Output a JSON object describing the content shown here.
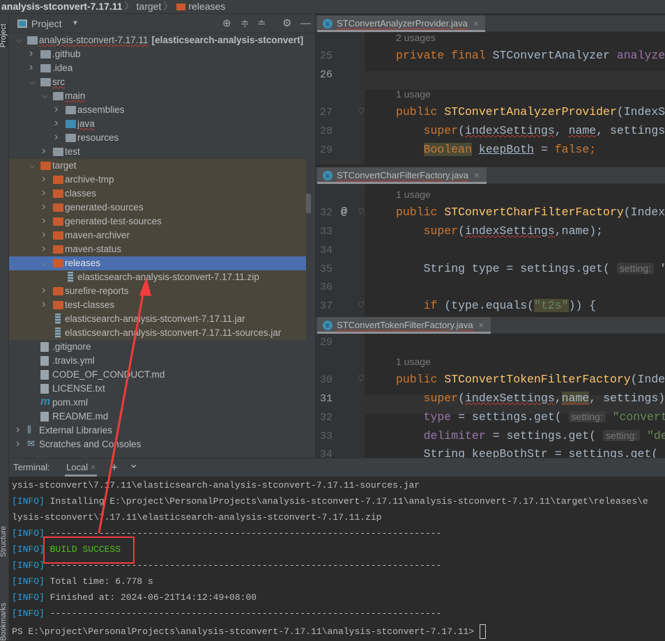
{
  "breadcrumb": [
    "analysis-stconvert-7.17.11",
    "target",
    "releases"
  ],
  "left_strip": {
    "project": "Project",
    "structure": "Structure",
    "bookmarks": "Bookmarks"
  },
  "project_panel": {
    "title": "Project",
    "icons": [
      "locate-icon",
      "expand-all-icon",
      "collapse-all-icon",
      "gear-icon",
      "minimize-icon"
    ]
  },
  "tree": [
    {
      "label": "analysis-stconvert-7.17.11",
      "extra": "[elasticsearch-analysis-stconvert]",
      "depth": 0,
      "icon": "module",
      "chevron": "open",
      "wavy": true
    },
    {
      "label": ".github",
      "depth": 1,
      "icon": "folder",
      "chevron": "closed"
    },
    {
      "label": ".idea",
      "depth": 1,
      "icon": "folder",
      "chevron": "closed"
    },
    {
      "label": "src",
      "depth": 1,
      "icon": "folder",
      "chevron": "open",
      "wavy": true
    },
    {
      "label": "main",
      "depth": 2,
      "icon": "folder",
      "chevron": "open",
      "wavy": true
    },
    {
      "label": "assemblies",
      "depth": 3,
      "icon": "folder",
      "chevron": "closed"
    },
    {
      "label": "java",
      "depth": 3,
      "icon": "source-folder",
      "chevron": "closed",
      "wavy": true
    },
    {
      "label": "resources",
      "depth": 3,
      "icon": "resource-folder",
      "chevron": "closed"
    },
    {
      "label": "test",
      "depth": 2,
      "icon": "folder",
      "chevron": "closed"
    },
    {
      "label": "target",
      "depth": 1,
      "icon": "excluded-folder",
      "chevron": "open",
      "state": "excluded"
    },
    {
      "label": "archive-tmp",
      "depth": 2,
      "icon": "excluded-folder",
      "chevron": "closed",
      "state": "excluded"
    },
    {
      "label": "classes",
      "depth": 2,
      "icon": "excluded-folder",
      "chevron": "closed",
      "state": "excluded"
    },
    {
      "label": "generated-sources",
      "depth": 2,
      "icon": "excluded-folder",
      "chevron": "closed",
      "state": "excluded"
    },
    {
      "label": "generated-test-sources",
      "depth": 2,
      "icon": "excluded-folder",
      "chevron": "closed",
      "state": "excluded"
    },
    {
      "label": "maven-archiver",
      "depth": 2,
      "icon": "excluded-folder",
      "chevron": "closed",
      "state": "excluded"
    },
    {
      "label": "maven-status",
      "depth": 2,
      "icon": "excluded-folder",
      "chevron": "closed",
      "state": "excluded"
    },
    {
      "label": "releases",
      "depth": 2,
      "icon": "excluded-folder",
      "chevron": "open",
      "state": "selected"
    },
    {
      "label": "elasticsearch-analysis-stconvert-7.17.11.zip",
      "depth": 3,
      "icon": "archive",
      "chevron": "none",
      "state": "excluded"
    },
    {
      "label": "surefire-reports",
      "depth": 2,
      "icon": "excluded-folder",
      "chevron": "closed",
      "state": "excluded"
    },
    {
      "label": "test-classes",
      "depth": 2,
      "icon": "excluded-folder",
      "chevron": "closed",
      "state": "excluded"
    },
    {
      "label": "elasticsearch-analysis-stconvert-7.17.11.jar",
      "depth": 2,
      "icon": "archive",
      "chevron": "none",
      "state": "excluded"
    },
    {
      "label": "elasticsearch-analysis-stconvert-7.17.11-sources.jar",
      "depth": 2,
      "icon": "archive",
      "chevron": "none",
      "state": "excluded"
    },
    {
      "label": ".gitignore",
      "depth": 1,
      "icon": "file",
      "chevron": "none"
    },
    {
      "label": ".travis.yml",
      "depth": 1,
      "icon": "yml-file",
      "chevron": "none"
    },
    {
      "label": "CODE_OF_CONDUCT.md",
      "depth": 1,
      "icon": "md-file",
      "chevron": "none"
    },
    {
      "label": "LICENSE.txt",
      "depth": 1,
      "icon": "text-file",
      "chevron": "none"
    },
    {
      "label": "pom.xml",
      "depth": 1,
      "icon": "maven-file",
      "chevron": "none"
    },
    {
      "label": "README.md",
      "depth": 1,
      "icon": "md-file",
      "chevron": "none"
    },
    {
      "label": "External Libraries",
      "depth": 0,
      "icon": "libraries",
      "chevron": "closed"
    },
    {
      "label": "Scratches and Consoles",
      "depth": 0,
      "icon": "scratches",
      "chevron": "closed"
    }
  ],
  "editor_panes": [
    {
      "tab": "STConvertAnalyzerProvider.java",
      "lines": [
        {
          "usage": "2 usages"
        },
        {
          "n": "25",
          "code": [
            [
              "private final ",
              "kw"
            ],
            [
              "STConvertAnalyzer ",
              ""
            ],
            [
              "analyze",
              "fd"
            ]
          ]
        },
        {
          "n": "26",
          "current": true,
          "code": []
        },
        {
          "usage": "1 usage"
        },
        {
          "n": "27",
          "fold": true,
          "code": [
            [
              "public ",
              "kw"
            ],
            [
              "STConvertAnalyzerProvider",
              "mt"
            ],
            [
              "(IndexS",
              ""
            ]
          ]
        },
        {
          "n": "28",
          "code": [
            [
              "    super",
              "kw"
            ],
            [
              "(",
              ""
            ],
            [
              "indexSettings",
              "sq"
            ],
            [
              ", ",
              ""
            ],
            [
              "name",
              "sq"
            ],
            [
              ", settings",
              ""
            ]
          ]
        },
        {
          "n": "29",
          "code": [
            [
              "    ",
              ""
            ],
            [
              "Boolean",
              "kw hlb"
            ],
            [
              " ",
              ""
            ],
            [
              "keepBoth",
              "ul"
            ],
            [
              " = ",
              ""
            ],
            [
              "false;",
              "kw"
            ]
          ]
        }
      ]
    },
    {
      "tab": "STConvertCharFilterFactory.java",
      "lines": [
        {
          "usage": "1 usage"
        },
        {
          "n": "32",
          "at": "@",
          "fold": true,
          "code": [
            [
              "public ",
              "kw"
            ],
            [
              "STConvertCharFilterFactory",
              "mt"
            ],
            [
              "(Index",
              ""
            ]
          ]
        },
        {
          "n": "33",
          "code": [
            [
              "    super",
              "kw"
            ],
            [
              "(",
              ""
            ],
            [
              "indexSettings",
              "sq"
            ],
            [
              ",name);",
              ""
            ]
          ]
        },
        {
          "n": "34",
          "code": []
        },
        {
          "n": "35",
          "code": [
            [
              "    String type = settings.get( ",
              ""
            ],
            [
              "setting:",
              "hint"
            ],
            [
              " \"",
              ""
            ]
          ]
        },
        {
          "n": "36",
          "code": []
        },
        {
          "n": "37",
          "fold": true,
          "code": [
            [
              "    if ",
              "kw"
            ],
            [
              "(type.equals(",
              ""
            ],
            [
              "\"t2s\"",
              "st hlb"
            ],
            [
              ")) {",
              ""
            ]
          ]
        }
      ]
    },
    {
      "tab": "STConvertTokenFilterFactory.java",
      "lines": [
        {
          "n": "29",
          "code": []
        },
        {
          "usage": "1 usage"
        },
        {
          "n": "30",
          "fold": true,
          "code": [
            [
              "public ",
              "kw"
            ],
            [
              "STConvertTokenFilterFactory",
              "mt"
            ],
            [
              "(Inde",
              ""
            ]
          ]
        },
        {
          "n": "31",
          "current": true,
          "code": [
            [
              "    super",
              "kw"
            ],
            [
              "(",
              ""
            ],
            [
              "indexSettings",
              "sq"
            ],
            [
              ",",
              ""
            ],
            [
              "name",
              "hlb sq"
            ],
            [
              ", settings)",
              ""
            ]
          ]
        },
        {
          "n": "32",
          "code": [
            [
              "    type",
              "fd"
            ],
            [
              " = settings.get( ",
              ""
            ],
            [
              "setting:",
              "hint"
            ],
            [
              " \"convert",
              "st"
            ]
          ]
        },
        {
          "n": "33",
          "code": [
            [
              "    delimiter",
              "fd"
            ],
            [
              " = settings.get( ",
              ""
            ],
            [
              "setting:",
              "hint"
            ],
            [
              " \"de",
              "st"
            ]
          ]
        },
        {
          "n": "34",
          "code": [
            [
              "    String keepBothStr = settings.get(",
              ""
            ]
          ]
        }
      ]
    }
  ],
  "terminal": {
    "label": "Terminal:",
    "tab": "Local",
    "add": "+",
    "dropdown": "⌄",
    "lines": [
      {
        "text": "ysis-stconvert\\7.17.11\\elasticsearch-analysis-stconvert-7.17.11-sources.jar"
      },
      {
        "prefix": "[INFO]",
        "text": " Installing E:\\project\\PersonalProjects\\analysis-stconvert-7.17.11\\analysis-stconvert-7.17.11\\target\\releases\\e"
      },
      {
        "text": "lysis-stconvert\\7.17.11\\elasticsearch-analysis-stconvert-7.17.11.zip"
      },
      {
        "prefix": "[INFO]",
        "text": " ------------------------------------------------------------------------"
      },
      {
        "prefix": "[INFO]",
        "text": " BUILD SUCCESS",
        "style": "green"
      },
      {
        "prefix": "[INFO]",
        "text": " ------------------------------------------------------------------------"
      },
      {
        "prefix": "[INFO]",
        "text": " Total time: 6.778 s"
      },
      {
        "prefix": "[INFO]",
        "text": " Finished at: 2024-06-21T14:12:49+08:00"
      },
      {
        "prefix": "[INFO]",
        "text": " ------------------------------------------------------------------------"
      },
      {
        "text": "PS E:\\project\\PersonalProjects\\analysis-stconvert-7.17.11\\analysis-stconvert-7.17.11> "
      }
    ]
  },
  "annotation_color": "#f23c3c"
}
